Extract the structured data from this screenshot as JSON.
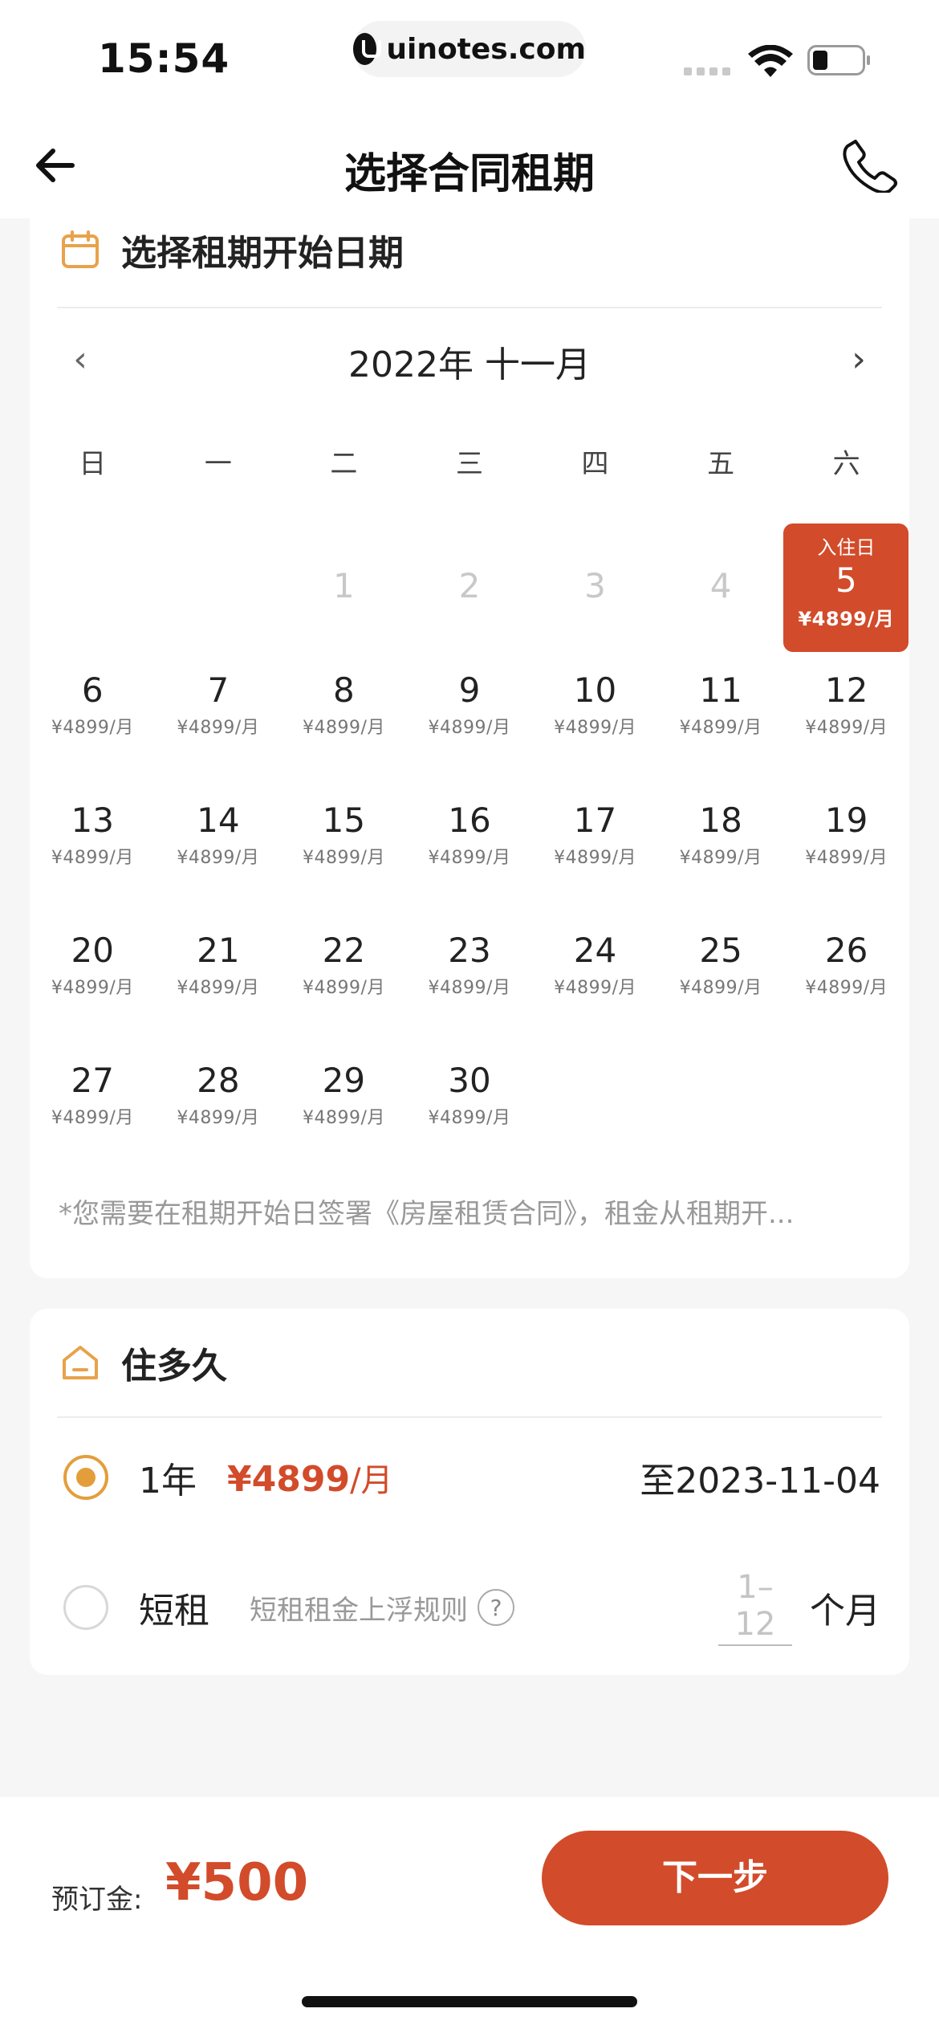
{
  "status_bar": {
    "time": "15:54",
    "url": "uinotes.com"
  },
  "nav": {
    "title": "选择合同租期"
  },
  "calendar_section": {
    "title": "选择租期开始日期",
    "month_label": "2022年 十一月",
    "prev": "‹",
    "next": "›",
    "weekdays": [
      "日",
      "一",
      "二",
      "三",
      "四",
      "五",
      "六"
    ],
    "price": "¥4899/月",
    "disabled_days": [
      {
        "col": 3,
        "day": "1"
      },
      {
        "col": 4,
        "day": "2"
      },
      {
        "col": 5,
        "day": "3"
      },
      {
        "col": 6,
        "day": "4"
      }
    ],
    "selected_day": {
      "tag": "入住日",
      "day": "5",
      "price": "¥4899/月"
    },
    "available_days": [
      "6",
      "7",
      "8",
      "9",
      "10",
      "11",
      "12",
      "13",
      "14",
      "15",
      "16",
      "17",
      "18",
      "19",
      "20",
      "21",
      "22",
      "23",
      "24",
      "25",
      "26",
      "27",
      "28",
      "29",
      "30"
    ],
    "note": "*您需要在租期开始日签署《房屋租赁合同》，租金从租期开..."
  },
  "duration_section": {
    "title": "住多久",
    "year_option": {
      "label": "1年",
      "price": "¥4899",
      "unit": "/月",
      "end_date": "至2023-11-04",
      "selected": true
    },
    "short_option": {
      "label": "短租",
      "rule_text": "短租租金上浮规则",
      "help": "?",
      "months_placeholder": "1–12",
      "months_unit": "个月",
      "selected": false
    }
  },
  "bottom_bar": {
    "deposit_label": "预订金:",
    "deposit_value": "¥500",
    "next_label": "下一步"
  },
  "colors": {
    "accent": "#d24b2a",
    "radio": "#e39e3b",
    "icon": "#e8a24a"
  }
}
